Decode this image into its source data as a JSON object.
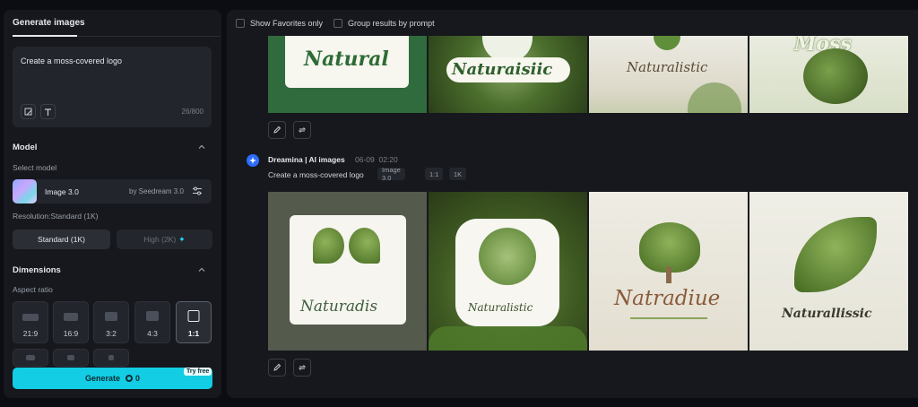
{
  "left_panel": {
    "tab": "Generate images",
    "prompt": {
      "text": "Create a moss-covered logo",
      "char_count": "26/800"
    },
    "model": {
      "section_title": "Model",
      "select_label": "Select model",
      "name": "Image 3.0",
      "provider": "by Seedream 3.0",
      "resolution_label": "Resolution:Standard (1K)",
      "resolution_options": [
        "Standard (1K)",
        "High (2K)"
      ],
      "resolution_selected": "Standard (1K)"
    },
    "dimensions": {
      "section_title": "Dimensions",
      "aspect_label": "Aspect ratio",
      "ratios": [
        "21:9",
        "16:9",
        "3:2",
        "4:3",
        "1:1"
      ],
      "selected_ratio": "1:1"
    },
    "generate": {
      "label": "Generate",
      "credits": "0",
      "badge": "Try free"
    }
  },
  "right_panel": {
    "filters": [
      "Show Favorites only",
      "Group results by prompt"
    ],
    "group_top": {
      "logo_texts": [
        "Natural",
        "Naturaisiic",
        "Naturalistic",
        "Moss"
      ]
    },
    "group_main": {
      "source": "Dreamina | AI images",
      "date": "06-09",
      "time": "02:20",
      "prompt": "Create a moss-covered logo",
      "tags": [
        "Image 3.0",
        "1:1",
        "1K"
      ],
      "logo_texts": [
        "Naturadis",
        "Naturalistic",
        "Natradiue",
        "Naturallissic"
      ]
    }
  },
  "colors": {
    "accent": "#12cde3",
    "panel": "#16181d",
    "moss": "#4f7a2c",
    "brand_blue": "#2c6dff"
  }
}
